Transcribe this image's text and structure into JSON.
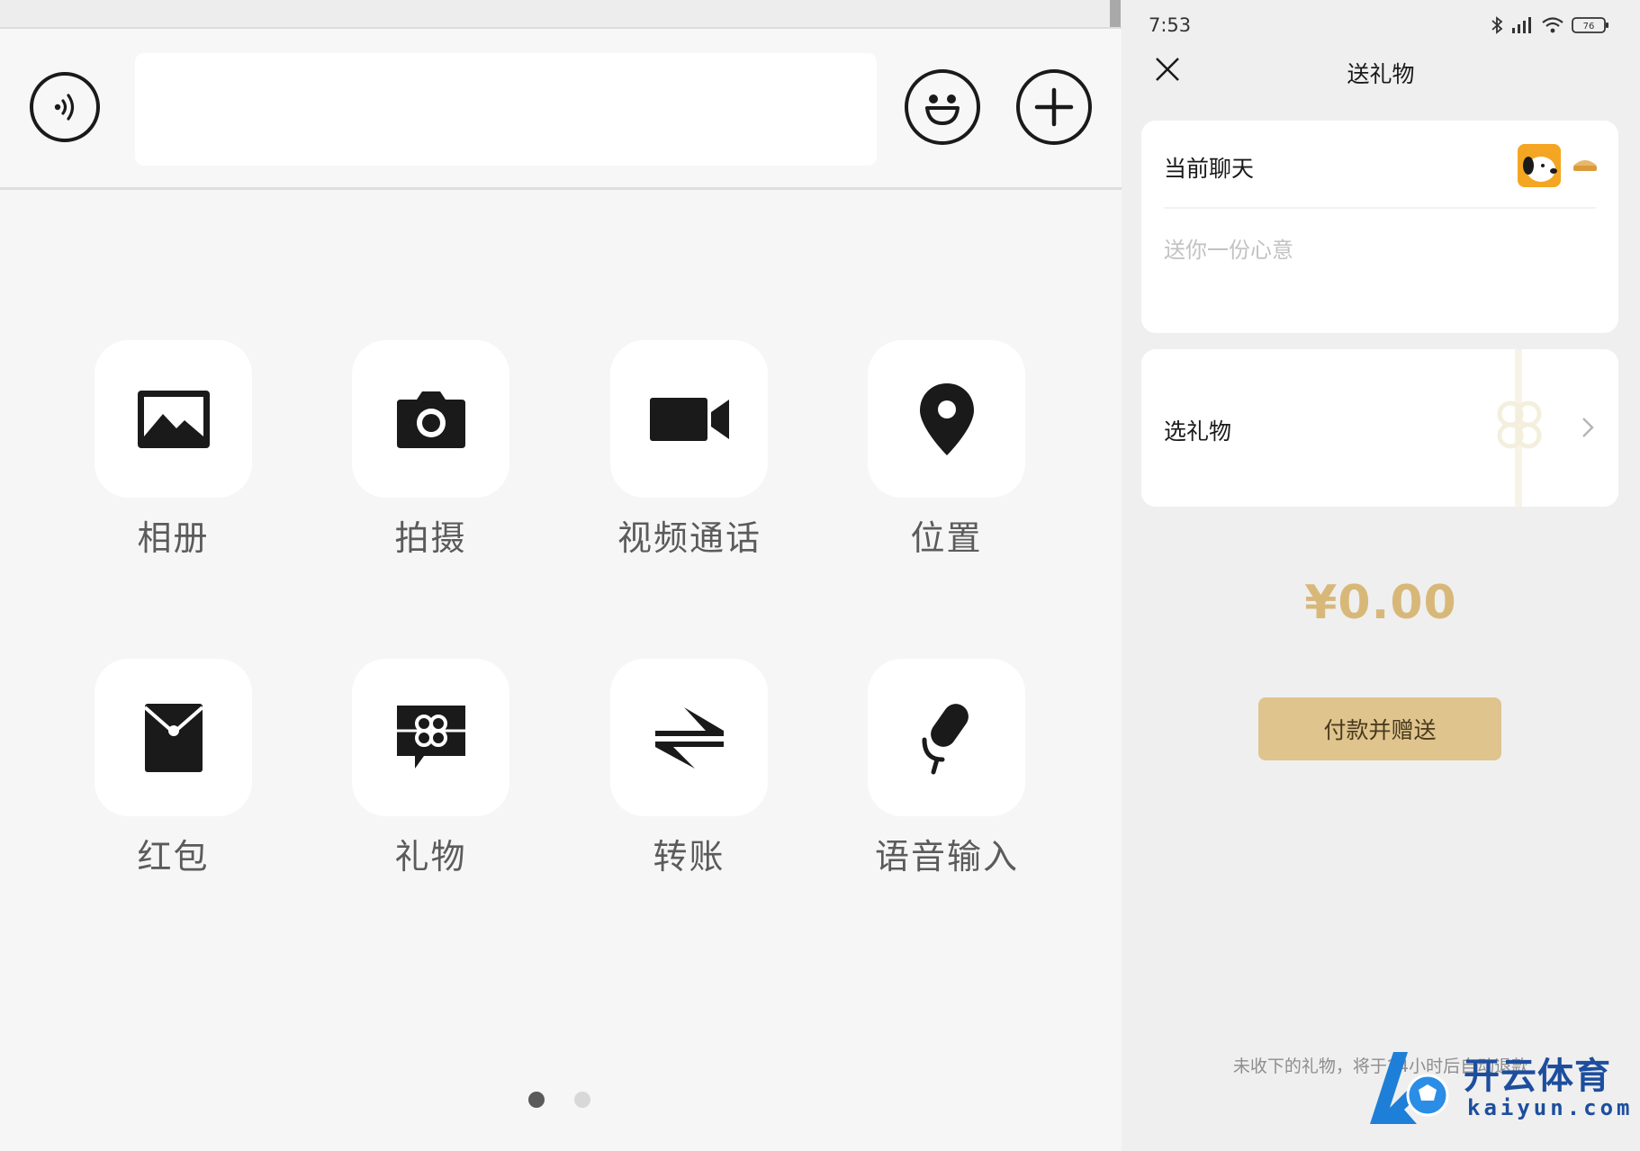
{
  "chat_panel": {
    "input": {
      "value": "",
      "placeholder": ""
    },
    "menu_items": [
      {
        "label": "相册",
        "icon": "photo-album-icon"
      },
      {
        "label": "拍摄",
        "icon": "camera-icon"
      },
      {
        "label": "视频通话",
        "icon": "video-call-icon"
      },
      {
        "label": "位置",
        "icon": "location-pin-icon"
      },
      {
        "label": "红包",
        "icon": "red-packet-icon"
      },
      {
        "label": "礼物",
        "icon": "gift-icon"
      },
      {
        "label": "转账",
        "icon": "transfer-icon"
      },
      {
        "label": "语音输入",
        "icon": "microphone-icon"
      }
    ],
    "page_indicator": {
      "current": 1,
      "total": 2
    }
  },
  "gift_panel": {
    "status_bar": {
      "time": "7:53",
      "battery": "76"
    },
    "title": "送礼物",
    "recipient_label": "当前聊天",
    "message_placeholder": "送你一份心意",
    "choose_gift_label": "选礼物",
    "amount": "¥0.00",
    "pay_button_label": "付款并赠送",
    "footnote": "未收下的礼物，将于24小时后自动退款",
    "colors": {
      "accent_gold": "#dfc48e",
      "amount_gold": "#d8b879"
    }
  },
  "watermark": {
    "brand": "开云体育",
    "domain": "kaiyun.com"
  }
}
